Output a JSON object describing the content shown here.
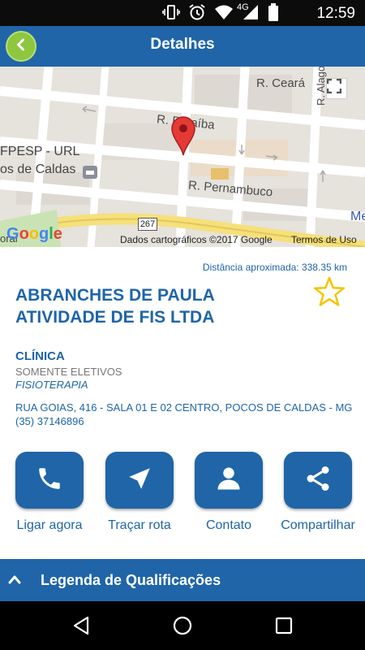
{
  "status_bar": {
    "time": "12:59",
    "network": "4G",
    "icons": [
      "vibrate-icon",
      "alarm-icon",
      "wifi-icon",
      "signal-icon",
      "battery-icon"
    ]
  },
  "app_bar": {
    "title": "Detalhes",
    "back_icon": "chevron-left-icon"
  },
  "map": {
    "streets": [
      "R. Ceará",
      "R. Paraíba",
      "R. Pernambuco",
      "R. Alagoas"
    ],
    "poi": [
      "FPESP - URL",
      "os de Caldas"
    ],
    "route_number": "267",
    "right_label": "Me",
    "bottom_left_label": "oral",
    "google_logo": "Google",
    "attribution": "Dados cartográficos ©2017 Google",
    "terms": "Termos de Uso",
    "pin_icon": "map-pin-icon",
    "fullscreen_icon": "fullscreen-icon"
  },
  "details": {
    "distance": "Distância aproximada: 338.35 km",
    "name": "ABRANCHES DE PAULA ATIVIDADE DE FIS LTDA",
    "category": "CLÍNICA",
    "subcategory": "SOMENTE ELETIVOS",
    "specialty": "FISIOTERAPIA",
    "address": "RUA GOIAS, 416 - SALA 01 E 02 CENTRO, POCOS DE CALDAS - MG",
    "phone": "(35) 37146896",
    "favorite_icon": "star-outline-icon"
  },
  "actions": [
    {
      "label": "Ligar agora",
      "icon": "phone-icon"
    },
    {
      "label": "Traçar rota",
      "icon": "navigation-arrow-icon"
    },
    {
      "label": "Contato",
      "icon": "person-icon"
    },
    {
      "label": "Compartilhar",
      "icon": "share-icon"
    }
  ],
  "legend": {
    "label": "Legenda de Qualificações",
    "icon": "chevron-up-icon"
  },
  "colors": {
    "primary": "#1f65a8",
    "back_button": "#8dc63f",
    "star": "#f5c400"
  }
}
